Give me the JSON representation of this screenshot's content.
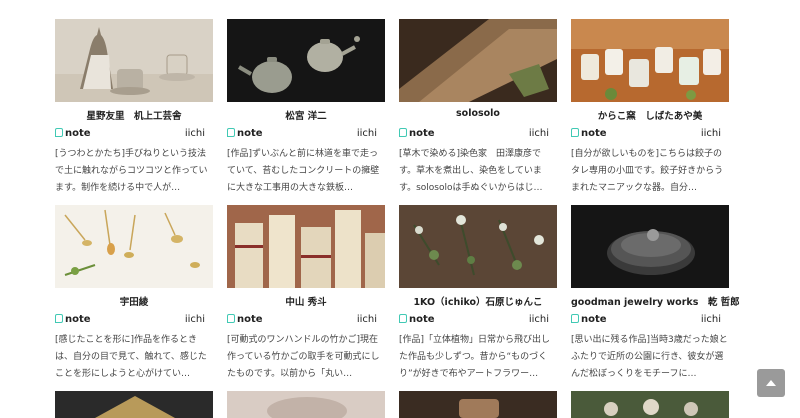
{
  "cards": [
    {
      "title": "星野友里　机上工芸舎",
      "brand": "note",
      "site": "iichi",
      "desc": "[うつわとかたち]手びねりという技法で土に触れながらコツコツと作っています。制作を続ける中で人が…",
      "thumb": "ceramics-vase-cups"
    },
    {
      "title": "松宮 洋二",
      "brand": "note",
      "site": "iichi",
      "desc": "[作品]ずいぶんと前に林道を車で走っていて、苔むしたコンクリートの擁壁に大きな工事用の大きな鉄板…",
      "thumb": "teapots-dark"
    },
    {
      "title": "solosolo",
      "brand": "note",
      "site": "iichi",
      "desc": "[草木で染める]染色家　田澤康彦です。草木を煮出し、染色をしています。solosoloは手ぬぐいからはじ…",
      "thumb": "dyed-cloth"
    },
    {
      "title": "からこ窯　しばたあや美",
      "brand": "note",
      "site": "iichi",
      "desc": "[自分が欲しいものを]こちらは餃子のタレ専用の小皿です。餃子好きからうまれたマニアックな器。自分…",
      "thumb": "small-cups"
    },
    {
      "title": "宇田綾",
      "brand": "note",
      "site": "iichi",
      "desc": "[感じたことを形に]作品を作るときは、自分の目で見て、触れて、感じたことを形にしようと心がけてい…",
      "thumb": "brass-leaves"
    },
    {
      "title": "中山 秀斗",
      "brand": "note",
      "site": "iichi",
      "desc": "[可動式のワンハンドルの竹かご]現在作っている竹かごの取手を可動式にしたものです。以前から「丸い…",
      "thumb": "bamboo-baskets"
    },
    {
      "title": "1KO（ichiko）石原じゅんこ",
      "brand": "note",
      "site": "iichi",
      "desc": "[作品]「立体植物」日常から飛び出した作品も少しずつ。昔から“ものづくり”が好きで布やアートフラワー…",
      "thumb": "fabric-plants"
    },
    {
      "title": "goodman jewelry works　乾 哲郎",
      "brand": "note",
      "site": "iichi",
      "desc": "[思い出に残る作品]当時3歳だった娘とふたりで近所の公園に行き、彼女が選んだ松ぼっくりをモチーフに…",
      "thumb": "glass-dish"
    }
  ],
  "scroll_top_label": "",
  "colors": {
    "accent": "#41c9b4",
    "scroll_button": "#9a9a9a"
  }
}
